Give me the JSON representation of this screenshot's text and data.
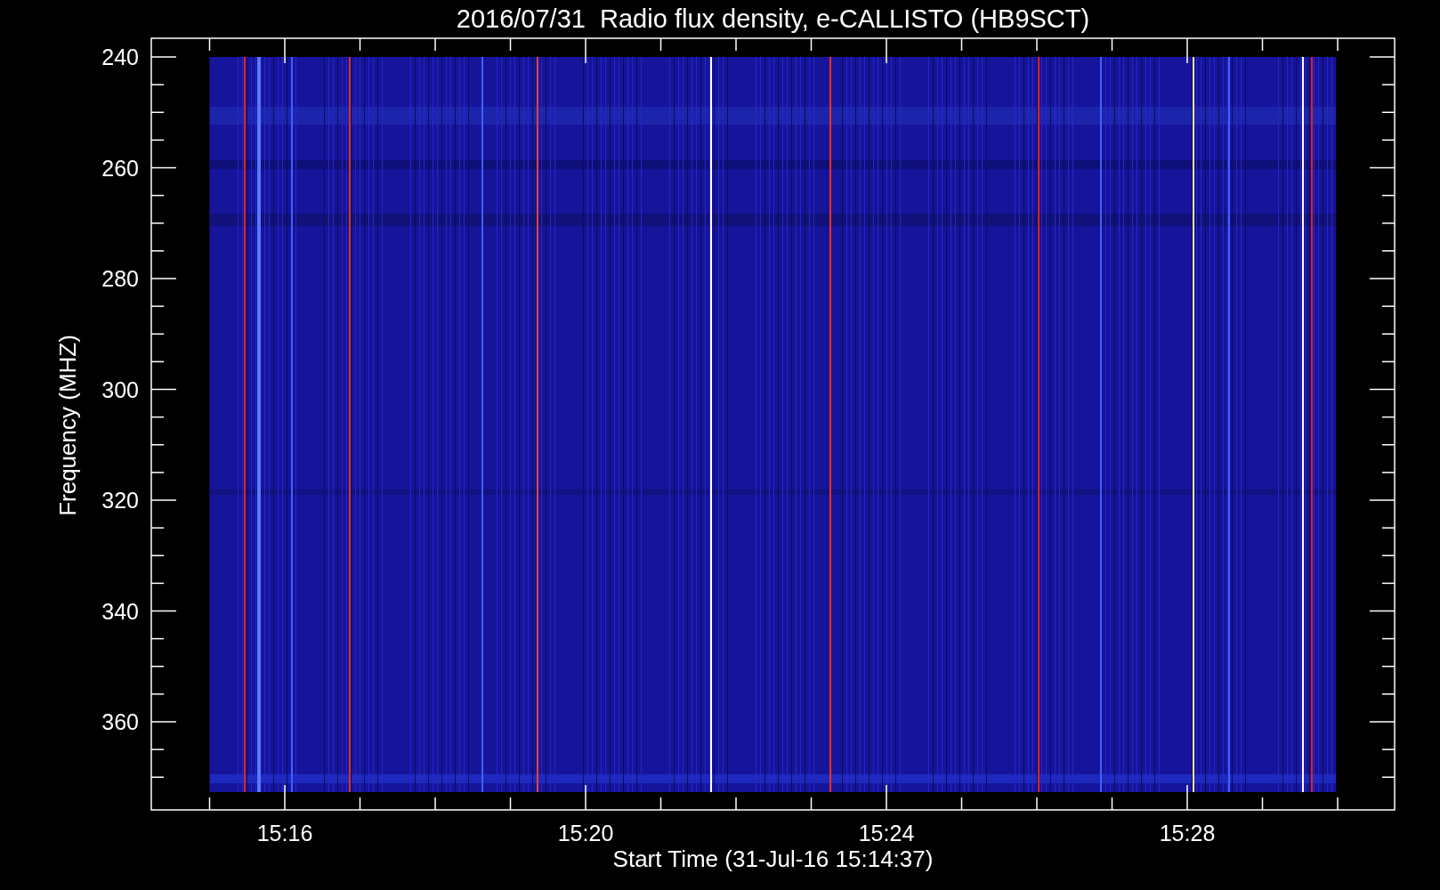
{
  "title": "2016/07/31  Radio flux density, e-CALLISTO (HB9SCT)",
  "axes": {
    "y_label": "Frequency (MHZ)",
    "y_tick_labels": [
      "240",
      "260",
      "280",
      "300",
      "320",
      "340",
      "360"
    ],
    "x_label": "Start Time (31-Jul-16 15:14:37)",
    "x_tick_labels": [
      "15:16",
      "15:20",
      "15:24",
      "15:28"
    ]
  }
}
